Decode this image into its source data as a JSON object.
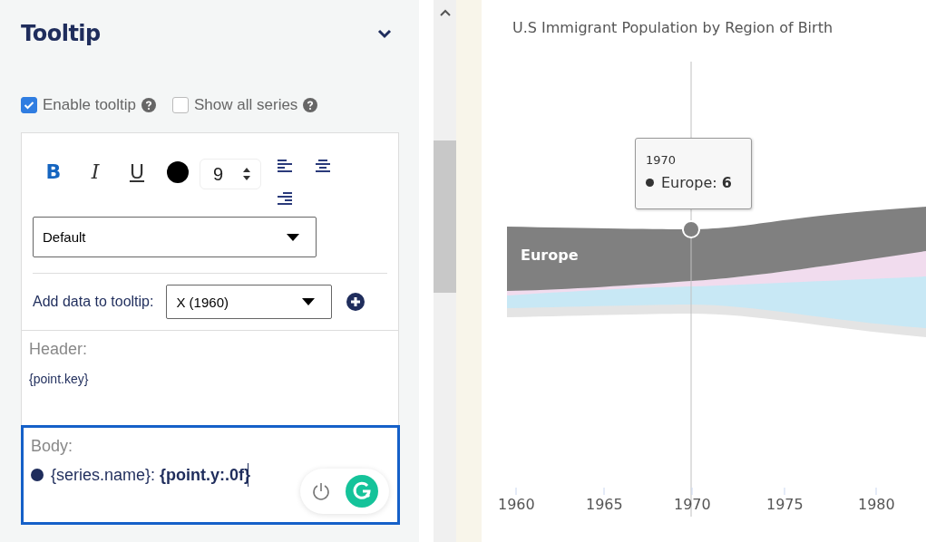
{
  "panel": {
    "title": "Tooltip",
    "expanded": true
  },
  "options": [
    {
      "label": "Enable tooltip",
      "checked": true
    },
    {
      "label": "Show all series",
      "checked": false
    }
  ],
  "format_buttons": [
    {
      "kind": "bold",
      "label": "B",
      "on": true
    },
    {
      "kind": "italic",
      "label": "I",
      "on": false
    },
    {
      "kind": "underline",
      "label": "U",
      "on": false
    }
  ],
  "font_size": "9",
  "font_select": {
    "value": "Default"
  },
  "add_data": {
    "label": "Add data to tooltip:",
    "value": "X (1960)"
  },
  "header": {
    "label": "Header:",
    "value": "{point.key}"
  },
  "body": {
    "label": "Body:",
    "value": "{series.name}: **{point.y:.0f}**",
    "focused": true
  },
  "chart": {
    "title": "U.S Immigrant Population by Region of Birth",
    "series_label": "Europe",
    "tooltip": {
      "header": "1970",
      "series": "Europe:",
      "value": "6"
    },
    "x_labels": [
      "1960",
      "1965",
      "1970",
      "1975",
      "1980"
    ]
  }
}
